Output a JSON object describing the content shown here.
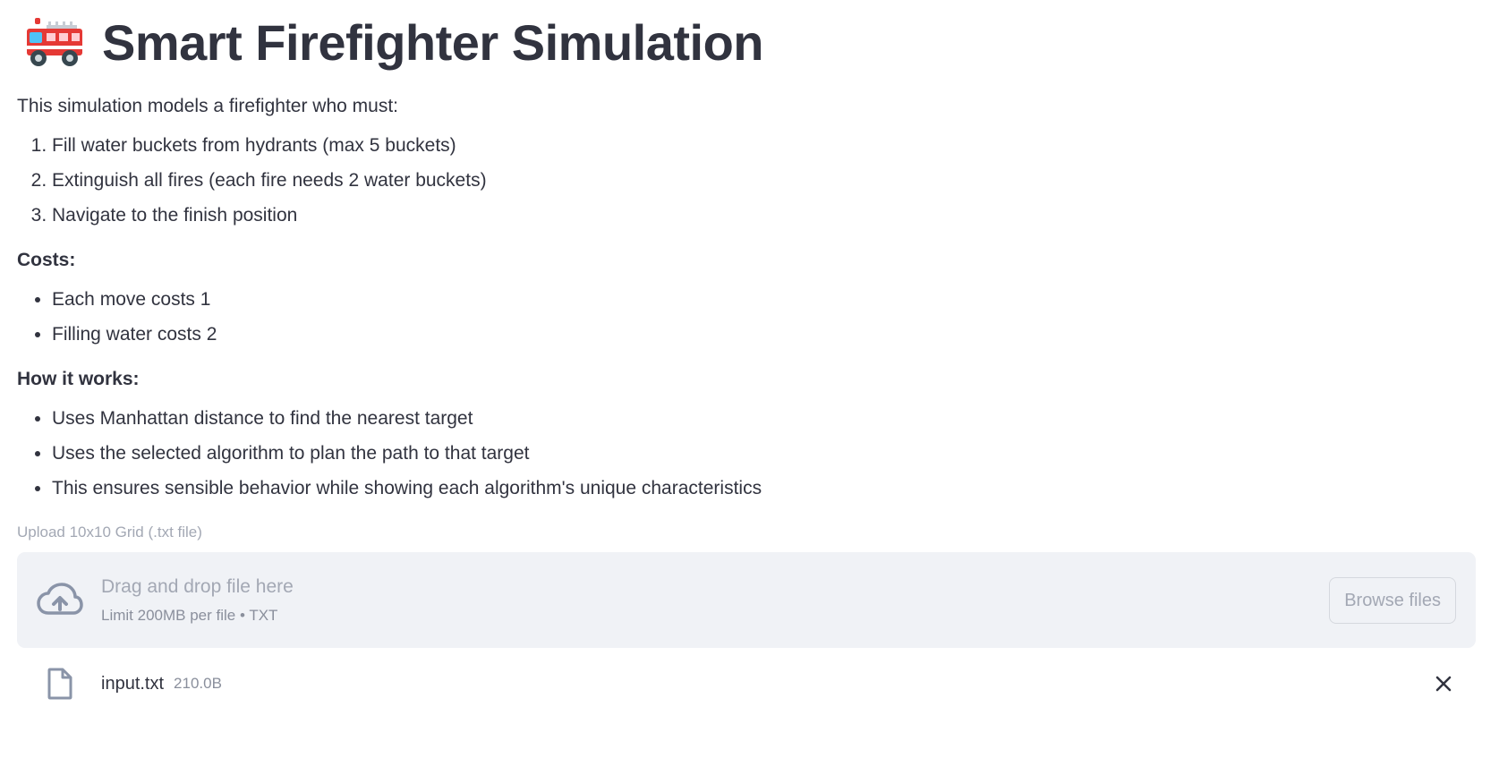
{
  "header": {
    "emoji": "🚒",
    "title": "Smart Firefighter Simulation"
  },
  "intro": "This simulation models a firefighter who must:",
  "steps": [
    "Fill water buckets from hydrants (max 5 buckets)",
    "Extinguish all fires (each fire needs 2 water buckets)",
    "Navigate to the finish position"
  ],
  "costs": {
    "heading": "Costs:",
    "items": [
      "Each move costs 1",
      "Filling water costs 2"
    ]
  },
  "how": {
    "heading": "How it works:",
    "items": [
      "Uses Manhattan distance to find the nearest target",
      "Uses the selected algorithm to plan the path to that target",
      "This ensures sensible behavior while showing each algorithm's unique characteristics"
    ]
  },
  "uploader": {
    "label": "Upload 10x10 Grid (.txt file)",
    "drop_text": "Drag and drop file here",
    "limit_text": "Limit 200MB per file • TXT",
    "browse_label": "Browse files"
  },
  "file": {
    "name": "input.txt",
    "size": "210.0B"
  },
  "icons": {
    "title": "fire-engine-icon",
    "cloud": "cloud-upload-icon",
    "file": "file-icon",
    "close": "close-icon"
  },
  "colors": {
    "text": "#31333f",
    "muted": "#a3a8b4",
    "dropzone_bg": "#f0f2f6",
    "icon": "#8a94a8"
  }
}
